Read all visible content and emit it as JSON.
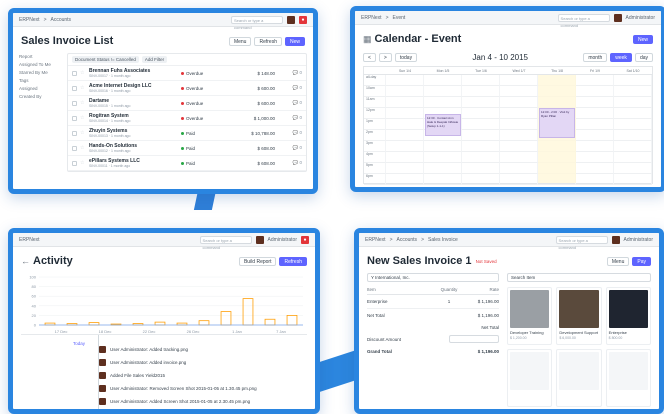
{
  "colors": {
    "frame": "#2a85e0",
    "primary": "#5e64ff",
    "danger": "#e3353a",
    "overdue": "#e3353a",
    "paid": "#28a745"
  },
  "common": {
    "search_placeholder": "Search or type a command",
    "user": "Administrator",
    "app": "ERPNext"
  },
  "invoice_list": {
    "breadcrumb_sep": ">",
    "breadcrumb": "Accounts",
    "title": "Sales Invoice List",
    "menu_label": "Menu",
    "refresh_label": "Refresh",
    "new_label": "New",
    "sidebar": [
      "Report",
      "Assigned To Me",
      "Starred By Me",
      "Tags",
      "Assigned",
      "Created By"
    ],
    "filter_label": "Document Status != Cancelled",
    "add_filter_label": "Add Filter",
    "rows": [
      {
        "name": "Brennan Fuhs Associates",
        "meta": "SINV-00017 · 1 month ago",
        "status": "Overdue",
        "status_color": "#e3353a",
        "amount": "$ 148.00",
        "comments": "0"
      },
      {
        "name": "Acme Internet Design LLC",
        "meta": "SINV-00016 · 1 month ago",
        "status": "Overdue",
        "status_color": "#e3353a",
        "amount": "$ 600.00",
        "comments": "0"
      },
      {
        "name": "Dartame",
        "meta": "SINV-00015 · 1 month ago",
        "status": "Overdue",
        "status_color": "#e3353a",
        "amount": "$ 600.00",
        "comments": "0"
      },
      {
        "name": "Rogitran System",
        "meta": "SINV-00014 · 1 month ago",
        "status": "Overdue",
        "status_color": "#e3353a",
        "amount": "$ 1,000.00",
        "comments": "0"
      },
      {
        "name": "Zhuyin Systems",
        "meta": "SINV-00013 · 1 month ago",
        "status": "Paid",
        "status_color": "#28a745",
        "amount": "$ 10,788.00",
        "comments": "0"
      },
      {
        "name": "Hands-On Solutions",
        "meta": "SINV-00012 · 1 month ago",
        "status": "Paid",
        "status_color": "#28a745",
        "amount": "$ 608.00",
        "comments": "0"
      },
      {
        "name": "ePillars Systems LLC",
        "meta": "SINV-00011 · 1 month ago",
        "status": "Paid",
        "status_color": "#28a745",
        "amount": "$ 608.00",
        "comments": "0"
      }
    ]
  },
  "calendar": {
    "breadcrumb": "Event",
    "title": "Calendar - Event",
    "new_label": "New",
    "prev": "<",
    "next": ">",
    "today_label": "today",
    "range": "Jan 4 - 10 2015",
    "views": [
      "month",
      "week",
      "day"
    ],
    "day_headers": [
      "Sun 1/4",
      "Mon 1/5",
      "Tue 1/6",
      "Wed 1/7",
      "Thu 1/8",
      "Fri 1/9",
      "Sat 1/10"
    ],
    "all_day_label": "all-day",
    "times": [
      "10am",
      "11am",
      "12pm",
      "1pm",
      "2pm",
      "3pm",
      "4pm",
      "5pm",
      "6pm"
    ],
    "events": [
      {
        "text": "12:30 · Contact Ann Hale & Deepak Inflowie (Setup 1-1-1)",
        "day": 1,
        "start_hour": 12.5,
        "end_hour": 14.5
      },
      {
        "text": "12:00 - 2:00 · Visit by Ryan Pillan",
        "day": 4,
        "start_hour": 12,
        "end_hour": 14.75
      }
    ],
    "today_day": 4
  },
  "activity": {
    "title": "Activity",
    "build_report_label": "Build Report",
    "refresh_label": "Refresh",
    "chart_data": {
      "type": "bar",
      "categories": [
        "17 Dec",
        "18 Dec",
        "22 Dec",
        "24 Dec",
        "28 Dec",
        "30 Dec",
        "1 Jan",
        "4 Jan",
        "7 Jan",
        "9 Jan",
        "11 Jan",
        "13 Jan"
      ],
      "values": [
        4,
        3,
        5,
        2,
        3,
        6,
        4,
        9,
        28,
        55,
        12,
        20
      ],
      "ylim": [
        0,
        100
      ],
      "yticks": [
        "100",
        "80",
        "60",
        "40",
        "20",
        "0"
      ],
      "xticks": [
        "17 Dec",
        "18 Dec",
        "22 Dec",
        "26 Dec",
        "1 Jan",
        "7 Jan"
      ],
      "xlabel": "",
      "ylabel": "",
      "title": "",
      "grid": true
    },
    "date_label": "Today",
    "items": [
      "User Administrator: Added tracking.png",
      "User Administrator: Added invoice.png",
      "Added File Sales Yield2015",
      "User Administrator: Removed Screen Shot 2015-01-05 at 1.30.45 pm.png",
      "User Administrator: Added Screen Shot 2015-01-05 at 2.30.45 pm.png"
    ]
  },
  "new_invoice": {
    "breadcrumbs": [
      "Accounts",
      "Sales Invoice"
    ],
    "title": "New Sales Invoice 1",
    "not_saved": "Not Saved",
    "menu_label": "Menu",
    "pay_label": "Pay",
    "customer": "Y International, Inc.",
    "search_placeholder": "Search Item",
    "col_item": "Item",
    "col_qty": "Quantity",
    "col_rate": "Rate",
    "items": [
      {
        "name": "Enterprise",
        "qty": "1",
        "rate": "$ 1,196.00"
      }
    ],
    "net_total_label": "Net Total",
    "net_total": "$ 1,196.00",
    "tax_label": "Net Total",
    "discount_label": "Discount Amount",
    "grand_total_label": "Grand Total",
    "grand_total": "$ 1,196.00",
    "products": [
      {
        "name": "Developer Training",
        "price": "$ 1,200.00",
        "img": "#9a9fa4"
      },
      {
        "name": "Development Support",
        "price": "$ 6,000.00",
        "img": "#5a4a3c"
      },
      {
        "name": "Enterprise",
        "price": "$ 800.00",
        "img": "#1f2530"
      },
      {
        "name": "",
        "price": "",
        "img": ""
      },
      {
        "name": "",
        "price": "",
        "img": ""
      },
      {
        "name": "",
        "price": "",
        "img": ""
      }
    ]
  }
}
